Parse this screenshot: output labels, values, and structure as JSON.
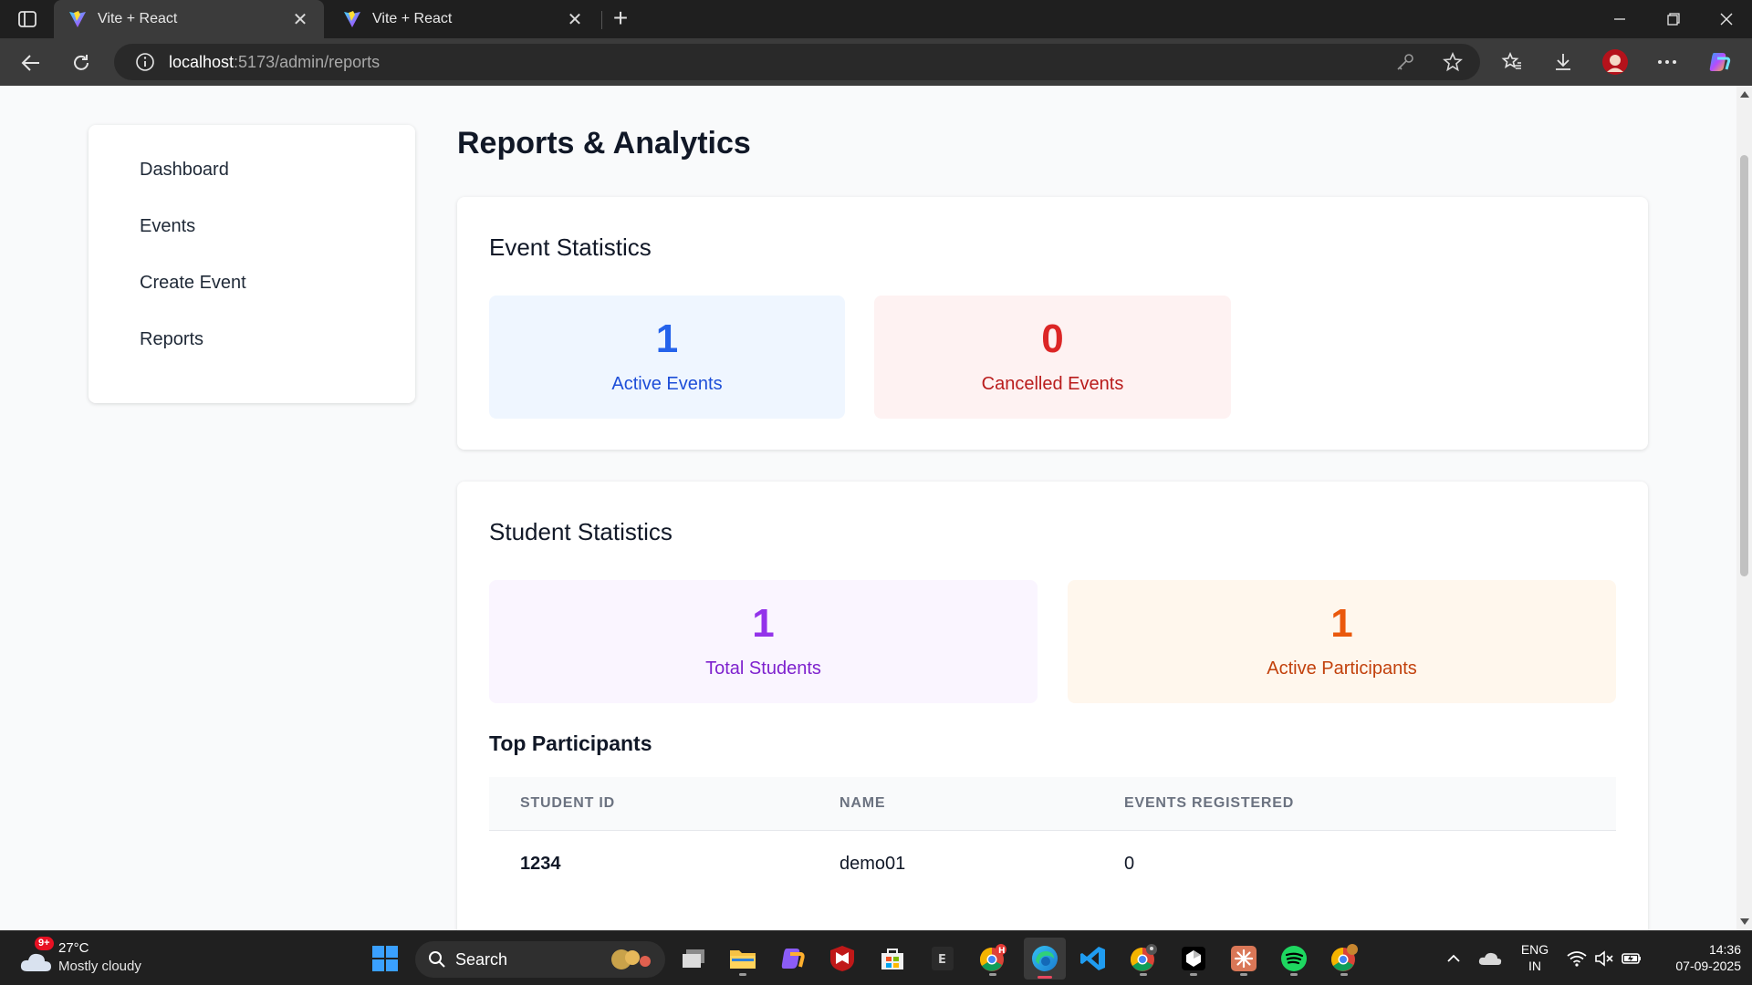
{
  "browser": {
    "tabs": [
      {
        "title": "Vite + React",
        "active": true
      },
      {
        "title": "Vite + React",
        "active": false
      }
    ],
    "url_host": "localhost",
    "url_rest": ":5173/admin/reports"
  },
  "sidebar": {
    "items": [
      {
        "label": "Dashboard"
      },
      {
        "label": "Events"
      },
      {
        "label": "Create Event"
      },
      {
        "label": "Reports"
      }
    ]
  },
  "page": {
    "title": "Reports & Analytics"
  },
  "event_stats": {
    "title": "Event Statistics",
    "active": {
      "value": "1",
      "label": "Active Events"
    },
    "cancelled": {
      "value": "0",
      "label": "Cancelled Events"
    }
  },
  "student_stats": {
    "title": "Student Statistics",
    "total": {
      "value": "1",
      "label": "Total Students"
    },
    "participants": {
      "value": "1",
      "label": "Active Participants"
    }
  },
  "top_participants": {
    "title": "Top Participants",
    "columns": [
      "STUDENT ID",
      "NAME",
      "EVENTS REGISTERED"
    ],
    "rows": [
      [
        "1234",
        "demo01",
        "0"
      ]
    ]
  },
  "taskbar": {
    "weather_temp": "27°C",
    "weather_cond": "Mostly cloudy",
    "weather_badge": "9+",
    "search_placeholder": "Search",
    "lang_1": "ENG",
    "lang_2": "IN",
    "time": "14:36",
    "date": "07-09-2025"
  },
  "colors": {
    "blue_card_bg": "#eff6ff",
    "blue_text": "#2563eb",
    "blue_label": "#1d4ed8",
    "red_card_bg": "#fef2f2",
    "red_text": "#dc2626",
    "red_label": "#b91c1c",
    "purple_card_bg": "#faf5ff",
    "purple_text": "#9333ea",
    "purple_label": "#7e22ce",
    "orange_card_bg": "#fff7ed",
    "orange_text": "#ea580c",
    "orange_label": "#c2410c"
  }
}
